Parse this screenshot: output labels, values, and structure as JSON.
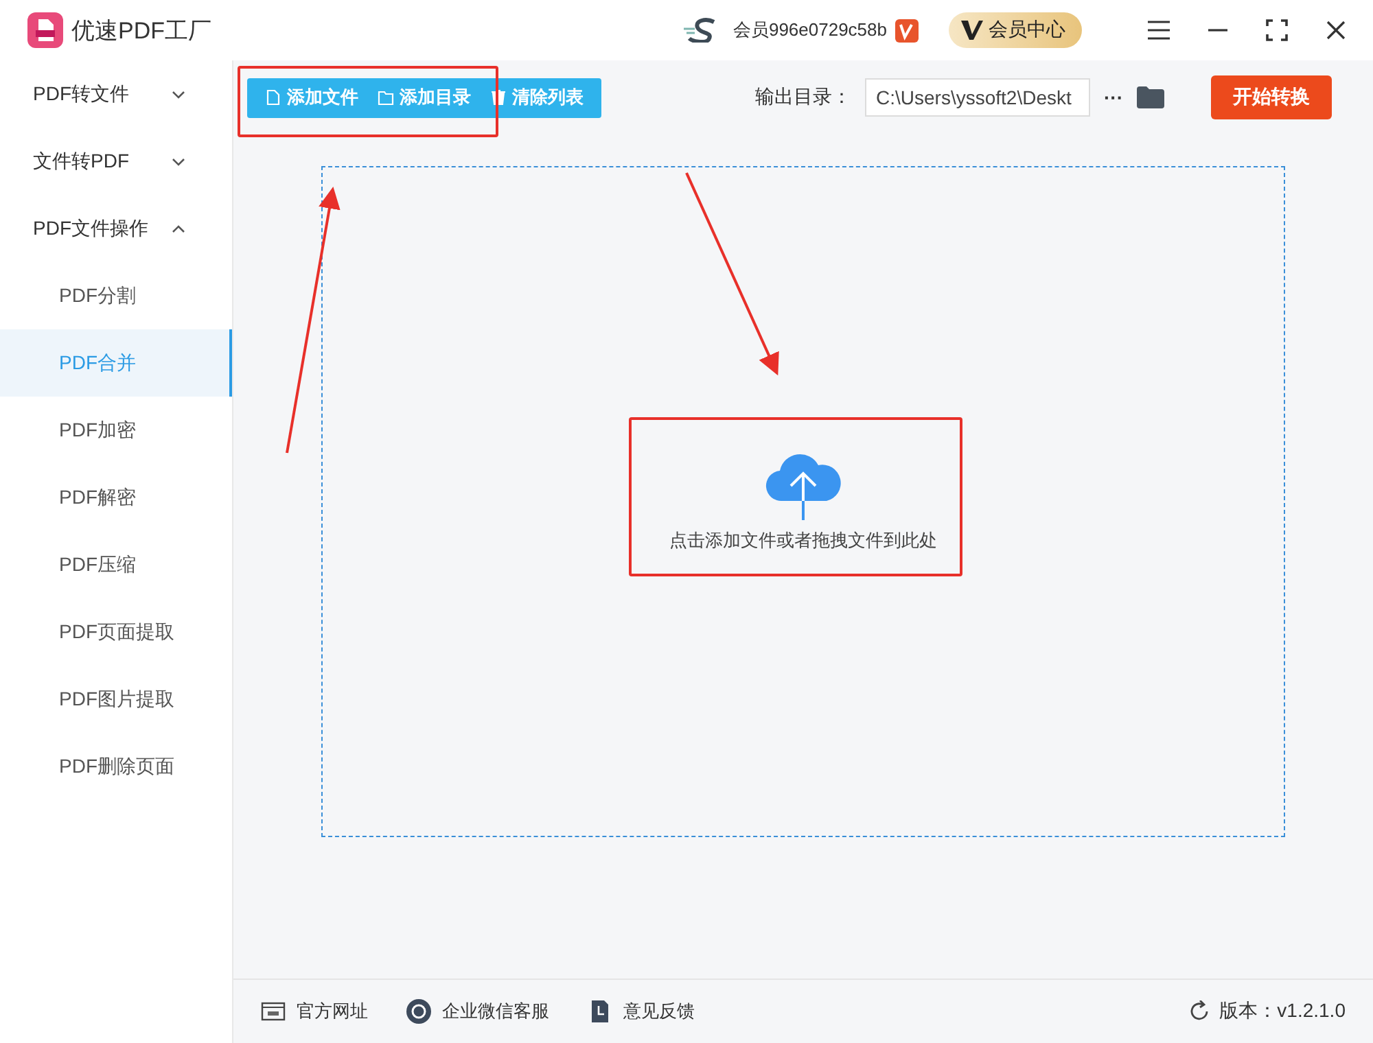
{
  "window": {
    "title": "优速PDF工厂",
    "account": "会员996e0729c58b",
    "vip_button": "会员中心"
  },
  "sidebar": {
    "items": [
      {
        "label": "PDF转文件",
        "expanded": false
      },
      {
        "label": "文件转PDF",
        "expanded": false
      },
      {
        "label": "PDF文件操作",
        "expanded": true,
        "children": [
          {
            "label": "PDF分割",
            "selected": false
          },
          {
            "label": "PDF合并",
            "selected": true
          },
          {
            "label": "PDF加密",
            "selected": false
          },
          {
            "label": "PDF解密",
            "selected": false
          },
          {
            "label": "PDF压缩",
            "selected": false
          },
          {
            "label": "PDF页面提取",
            "selected": false
          },
          {
            "label": "PDF图片提取",
            "selected": false
          },
          {
            "label": "PDF删除页面",
            "selected": false
          }
        ]
      }
    ]
  },
  "toolbar": {
    "buttons": [
      {
        "kind": "file",
        "label": "添加文件"
      },
      {
        "kind": "folder",
        "label": "添加目录"
      },
      {
        "kind": "trash",
        "label": "清除列表"
      }
    ],
    "output_label": "输出目录：",
    "output_path": "C:\\Users\\yssoft2\\Deskt",
    "more": "···",
    "start_button": "开始转换"
  },
  "drop_zone": {
    "hint": "点击添加文件或者拖拽文件到此处"
  },
  "status_bar": {
    "links": [
      {
        "kind": "web",
        "label": "官方网址"
      },
      {
        "kind": "chat",
        "label": "企业微信客服"
      },
      {
        "kind": "feedback",
        "label": "意见反馈"
      }
    ],
    "version": "版本：v1.2.1.0"
  }
}
